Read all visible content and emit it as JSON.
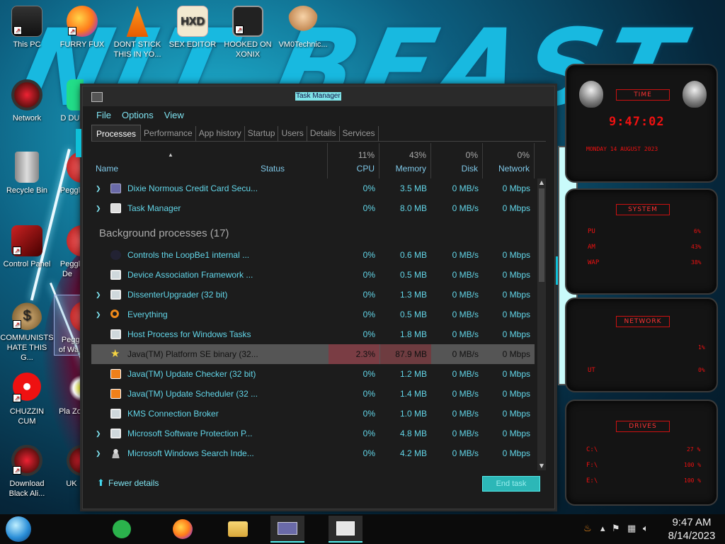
{
  "desktop": {
    "icons": [
      {
        "label": "This PC"
      },
      {
        "label": "FURRY FUX"
      },
      {
        "label": "DONT STICK THIS IN YO..."
      },
      {
        "label": "SEX EDITOR"
      },
      {
        "label": "HOOKED ON XONIX"
      },
      {
        "label": "VM0Technic..."
      },
      {
        "label": "Network"
      },
      {
        "label": "Recycle Bin"
      },
      {
        "label": "Control Panel"
      },
      {
        "label": "COMMUNISTS HATE THIS G..."
      },
      {
        "label": "CHUZZIN CUM"
      },
      {
        "label": "Download Black Ali..."
      },
      {
        "label": "Peggl"
      },
      {
        "label": "Peggl De"
      },
      {
        "label": "Peggl of Wa"
      },
      {
        "label": "Pla Zo"
      },
      {
        "label": "UK"
      },
      {
        "label": "D DU"
      }
    ]
  },
  "task_manager": {
    "title": "Task Manager",
    "menu": [
      "File",
      "Options",
      "View"
    ],
    "tabs": [
      "Processes",
      "Performance",
      "App history",
      "Startup",
      "Users",
      "Details",
      "Services"
    ],
    "active_tab": "Processes",
    "columns": {
      "name": "Name",
      "status": "Status",
      "cpu": {
        "pct": "11%",
        "label": "CPU"
      },
      "memory": {
        "pct": "43%",
        "label": "Memory"
      },
      "disk": {
        "pct": "0%",
        "label": "Disk"
      },
      "network": {
        "pct": "0%",
        "label": "Network"
      }
    },
    "apps": [
      {
        "name": "Dixie Normous Credit Card Secu...",
        "cpu": "0%",
        "memory": "3.5 MB",
        "disk": "0 MB/s",
        "network": "0 Mbps",
        "expandable": true,
        "icon": "card-icon"
      },
      {
        "name": "Task Manager",
        "cpu": "0%",
        "memory": "8.0 MB",
        "disk": "0 MB/s",
        "network": "0 Mbps",
        "expandable": true,
        "icon": "taskmgr-icon"
      }
    ],
    "background_group_label": "Background processes (17)",
    "background": [
      {
        "name": "Controls the LoopBe1 internal ...",
        "cpu": "0%",
        "memory": "0.6 MB",
        "disk": "0 MB/s",
        "network": "0 Mbps",
        "expandable": false,
        "icon": "loopbe-icon"
      },
      {
        "name": "Device Association Framework ...",
        "cpu": "0%",
        "memory": "0.5 MB",
        "disk": "0 MB/s",
        "network": "0 Mbps",
        "expandable": false,
        "icon": "window-icon"
      },
      {
        "name": "DissenterUpgrader (32 bit)",
        "cpu": "0%",
        "memory": "1.3 MB",
        "disk": "0 MB/s",
        "network": "0 Mbps",
        "expandable": true,
        "icon": "window-icon"
      },
      {
        "name": "Everything",
        "cpu": "0%",
        "memory": "0.5 MB",
        "disk": "0 MB/s",
        "network": "0 Mbps",
        "expandable": true,
        "icon": "search-icon"
      },
      {
        "name": "Host Process for Windows Tasks",
        "cpu": "0%",
        "memory": "1.8 MB",
        "disk": "0 MB/s",
        "network": "0 Mbps",
        "expandable": false,
        "icon": "window-icon"
      },
      {
        "name": "Java(TM) Platform SE binary (32...",
        "cpu": "2.3%",
        "memory": "87.9 MB",
        "disk": "0 MB/s",
        "network": "0 Mbps",
        "expandable": false,
        "icon": "star-icon",
        "selected": true
      },
      {
        "name": "Java(TM) Update Checker (32 bit)",
        "cpu": "0%",
        "memory": "1.2 MB",
        "disk": "0 MB/s",
        "network": "0 Mbps",
        "expandable": false,
        "icon": "java-icon"
      },
      {
        "name": "Java(TM) Update Scheduler (32 ...",
        "cpu": "0%",
        "memory": "1.4 MB",
        "disk": "0 MB/s",
        "network": "0 Mbps",
        "expandable": false,
        "icon": "java-icon"
      },
      {
        "name": "KMS Connection Broker",
        "cpu": "0%",
        "memory": "1.0 MB",
        "disk": "0 MB/s",
        "network": "0 Mbps",
        "expandable": false,
        "icon": "window-icon"
      },
      {
        "name": "Microsoft Software Protection P...",
        "cpu": "0%",
        "memory": "4.8 MB",
        "disk": "0 MB/s",
        "network": "0 Mbps",
        "expandable": true,
        "icon": "window-icon"
      },
      {
        "name": "Microsoft Windows Search Inde...",
        "cpu": "0%",
        "memory": "4.2 MB",
        "disk": "0 MB/s",
        "network": "0 Mbps",
        "expandable": true,
        "icon": "user-icon"
      }
    ],
    "footer": {
      "fewer_details": "Fewer details",
      "end_task": "End task"
    }
  },
  "gadgets": {
    "time": {
      "title": "TIME",
      "clock": "9:47:02",
      "date": "MONDAY 14 AUGUST 2023"
    },
    "system": {
      "title": "SYSTEM",
      "cpu_label": "PU",
      "cpu_val": "6%",
      "ram_label": "AM",
      "ram_val": "43%",
      "swap_label": "WAP",
      "swap_val": "38%"
    },
    "network": {
      "title": "NETWORK",
      "in_val": "1%",
      "out_label": "UT",
      "out_val": "0%"
    },
    "drives": {
      "title": "DRIVES",
      "items": [
        {
          "label": "C:\\",
          "val": "27 %"
        },
        {
          "label": "F:\\",
          "val": "100 %"
        },
        {
          "label": "E:\\",
          "val": "100 %"
        }
      ]
    }
  },
  "taskbar": {
    "pins": [
      "feedly-icon",
      "firefox-icon",
      "file-explorer-icon",
      "credit-card-app-icon",
      "task-manager-icon"
    ],
    "clock_time": "9:47 AM",
    "clock_date": "8/14/2023"
  },
  "colors": {
    "accent": "#62d5e8",
    "selected_row": "#555555",
    "end_task_bg": "#2cb7b7",
    "gadget_red": "#ee1111"
  }
}
